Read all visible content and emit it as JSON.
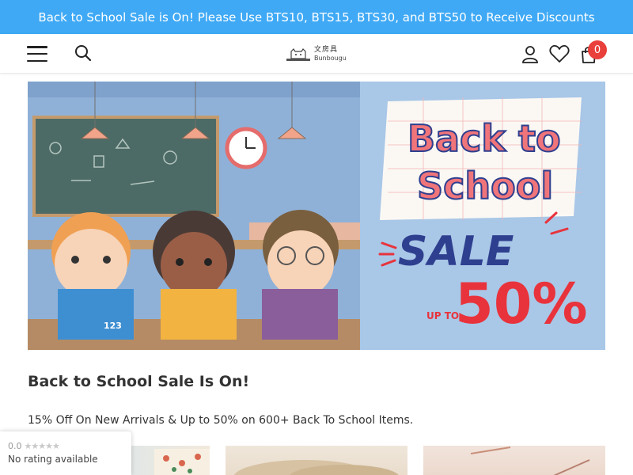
{
  "announcement": {
    "text": "Back to School Sale is On! Please Use BTS10, BTS15, BTS30, and BTS50 to Receive Discounts"
  },
  "header": {
    "logo": {
      "cn": "文房具",
      "en": "Bunbougu"
    },
    "cart_count": "0"
  },
  "banner": {
    "line1": "Back to",
    "line2": "School",
    "sale": "SALE",
    "upto": "UP TO",
    "percent": "50%",
    "laptop_sticker": "123"
  },
  "section": {
    "title": "Back to School Sale Is On!",
    "subtitle": "15% Off On New Arrivals & Up to 50% on 600+ Back To School Items."
  },
  "rating": {
    "score": "0.0",
    "stars": "★★★★★",
    "text": "No rating available"
  },
  "colors": {
    "announcement_bg": "#3fa9f5",
    "cart_badge": "#e9403b",
    "banner_pink": "#f0757a",
    "banner_red": "#e8333c",
    "banner_navy": "#2e3f8f"
  }
}
